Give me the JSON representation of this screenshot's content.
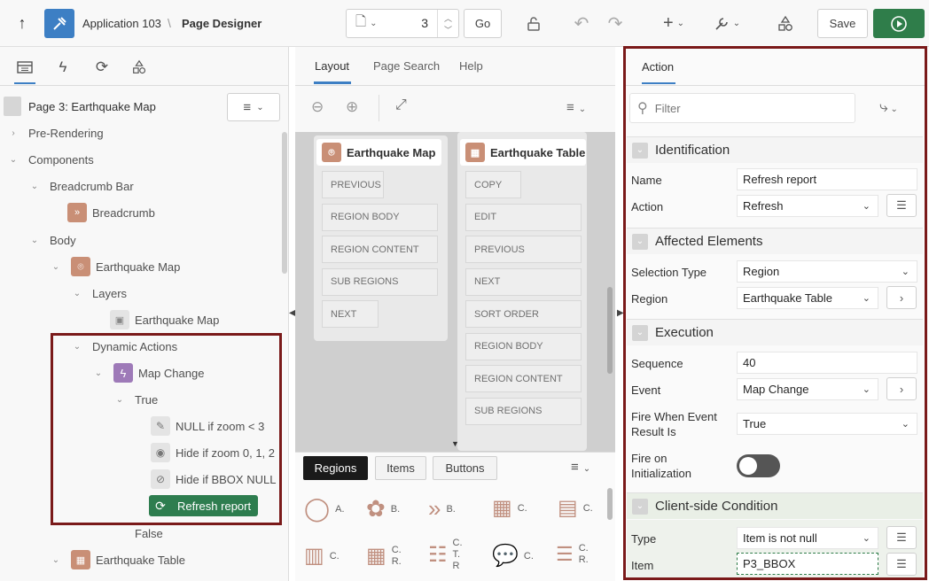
{
  "header": {
    "app_name": "Application 103",
    "separator": "\\",
    "page_title": "Page Designer",
    "page_number": "3",
    "go_label": "Go",
    "save_label": "Save"
  },
  "left": {
    "page_label": "Page 3: Earthquake Map",
    "tree": {
      "pre_rendering": "Pre-Rendering",
      "components": "Components",
      "breadcrumb_bar": "Breadcrumb Bar",
      "breadcrumb": "Breadcrumb",
      "body": "Body",
      "earthquake_map": "Earthquake Map",
      "layers": "Layers",
      "layer_earthquake_map": "Earthquake Map",
      "dynamic_actions": "Dynamic Actions",
      "map_change": "Map Change",
      "true_label": "True",
      "null_if_zoom": "NULL if zoom < 3",
      "hide_if_zoom": "Hide if zoom 0, 1, 2",
      "hide_if_bbox": "Hide if BBOX NULL",
      "refresh_report": "Refresh report",
      "false_label": "False",
      "earthquake_table": "Earthquake Table"
    }
  },
  "middle": {
    "tabs": [
      "Layout",
      "Page Search",
      "Help"
    ],
    "regions": {
      "map_title": "Earthquake Map",
      "map_slots": [
        "PREVIOUS",
        "REGION BODY",
        "REGION CONTENT",
        "SUB REGIONS",
        "NEXT"
      ],
      "table_title": "Earthquake Table",
      "table_slots": [
        "COPY",
        "EDIT",
        "PREVIOUS",
        "NEXT",
        "SORT ORDER",
        "REGION BODY",
        "REGION CONTENT",
        "SUB REGIONS"
      ]
    },
    "gallery": {
      "tabs": [
        "Regions",
        "Items",
        "Buttons"
      ],
      "row1": [
        "A.",
        "B.",
        "B.",
        "C.",
        "C."
      ],
      "row2": [
        "C.",
        "C.\nR.",
        "C.\nT.\nR",
        "C.",
        "C.\nR."
      ]
    }
  },
  "right": {
    "tab": "Action",
    "filter_placeholder": "Filter",
    "identification": {
      "title": "Identification",
      "name_label": "Name",
      "name_value": "Refresh report",
      "action_label": "Action",
      "action_value": "Refresh"
    },
    "affected": {
      "title": "Affected Elements",
      "selection_type_label": "Selection Type",
      "selection_type_value": "Region",
      "region_label": "Region",
      "region_value": "Earthquake Table"
    },
    "execution": {
      "title": "Execution",
      "sequence_label": "Sequence",
      "sequence_value": "40",
      "event_label": "Event",
      "event_value": "Map Change",
      "fire_when_label": "Fire When Event Result Is",
      "fire_when_value": "True",
      "fire_on_init_label": "Fire on Initialization",
      "fire_on_init": false
    },
    "client_condition": {
      "title": "Client-side Condition",
      "type_label": "Type",
      "type_value": "Item is not null",
      "item_label": "Item",
      "item_value": "P3_BBOX"
    }
  },
  "colors": {
    "accent_blue": "#3d7fc4",
    "run_green": "#2f7d4a",
    "highlight_border": "#7a1a1a",
    "selected_node": "#2e7d4f",
    "region_icon": "#c98f76",
    "da_icon": "#9e7ab8"
  }
}
